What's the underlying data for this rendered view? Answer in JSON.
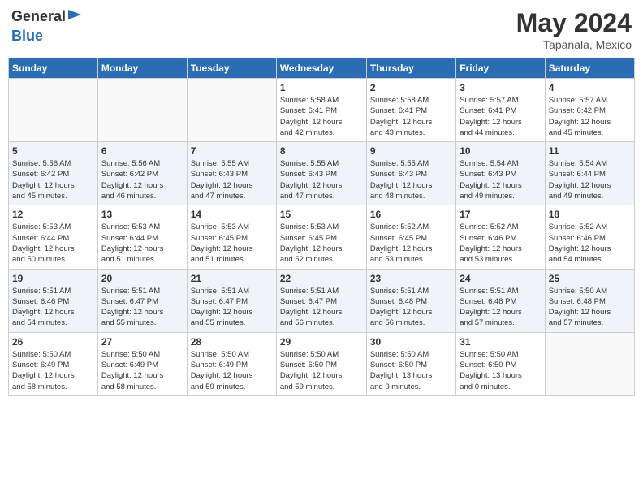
{
  "header": {
    "logo_general": "General",
    "logo_blue": "Blue",
    "month": "May 2024",
    "location": "Tapanala, Mexico"
  },
  "weekdays": [
    "Sunday",
    "Monday",
    "Tuesday",
    "Wednesday",
    "Thursday",
    "Friday",
    "Saturday"
  ],
  "weeks": [
    [
      {
        "day": "",
        "info": ""
      },
      {
        "day": "",
        "info": ""
      },
      {
        "day": "",
        "info": ""
      },
      {
        "day": "1",
        "info": "Sunrise: 5:58 AM\nSunset: 6:41 PM\nDaylight: 12 hours\nand 42 minutes."
      },
      {
        "day": "2",
        "info": "Sunrise: 5:58 AM\nSunset: 6:41 PM\nDaylight: 12 hours\nand 43 minutes."
      },
      {
        "day": "3",
        "info": "Sunrise: 5:57 AM\nSunset: 6:41 PM\nDaylight: 12 hours\nand 44 minutes."
      },
      {
        "day": "4",
        "info": "Sunrise: 5:57 AM\nSunset: 6:42 PM\nDaylight: 12 hours\nand 45 minutes."
      }
    ],
    [
      {
        "day": "5",
        "info": "Sunrise: 5:56 AM\nSunset: 6:42 PM\nDaylight: 12 hours\nand 45 minutes."
      },
      {
        "day": "6",
        "info": "Sunrise: 5:56 AM\nSunset: 6:42 PM\nDaylight: 12 hours\nand 46 minutes."
      },
      {
        "day": "7",
        "info": "Sunrise: 5:55 AM\nSunset: 6:43 PM\nDaylight: 12 hours\nand 47 minutes."
      },
      {
        "day": "8",
        "info": "Sunrise: 5:55 AM\nSunset: 6:43 PM\nDaylight: 12 hours\nand 47 minutes."
      },
      {
        "day": "9",
        "info": "Sunrise: 5:55 AM\nSunset: 6:43 PM\nDaylight: 12 hours\nand 48 minutes."
      },
      {
        "day": "10",
        "info": "Sunrise: 5:54 AM\nSunset: 6:43 PM\nDaylight: 12 hours\nand 49 minutes."
      },
      {
        "day": "11",
        "info": "Sunrise: 5:54 AM\nSunset: 6:44 PM\nDaylight: 12 hours\nand 49 minutes."
      }
    ],
    [
      {
        "day": "12",
        "info": "Sunrise: 5:53 AM\nSunset: 6:44 PM\nDaylight: 12 hours\nand 50 minutes."
      },
      {
        "day": "13",
        "info": "Sunrise: 5:53 AM\nSunset: 6:44 PM\nDaylight: 12 hours\nand 51 minutes."
      },
      {
        "day": "14",
        "info": "Sunrise: 5:53 AM\nSunset: 6:45 PM\nDaylight: 12 hours\nand 51 minutes."
      },
      {
        "day": "15",
        "info": "Sunrise: 5:53 AM\nSunset: 6:45 PM\nDaylight: 12 hours\nand 52 minutes."
      },
      {
        "day": "16",
        "info": "Sunrise: 5:52 AM\nSunset: 6:45 PM\nDaylight: 12 hours\nand 53 minutes."
      },
      {
        "day": "17",
        "info": "Sunrise: 5:52 AM\nSunset: 6:46 PM\nDaylight: 12 hours\nand 53 minutes."
      },
      {
        "day": "18",
        "info": "Sunrise: 5:52 AM\nSunset: 6:46 PM\nDaylight: 12 hours\nand 54 minutes."
      }
    ],
    [
      {
        "day": "19",
        "info": "Sunrise: 5:51 AM\nSunset: 6:46 PM\nDaylight: 12 hours\nand 54 minutes."
      },
      {
        "day": "20",
        "info": "Sunrise: 5:51 AM\nSunset: 6:47 PM\nDaylight: 12 hours\nand 55 minutes."
      },
      {
        "day": "21",
        "info": "Sunrise: 5:51 AM\nSunset: 6:47 PM\nDaylight: 12 hours\nand 55 minutes."
      },
      {
        "day": "22",
        "info": "Sunrise: 5:51 AM\nSunset: 6:47 PM\nDaylight: 12 hours\nand 56 minutes."
      },
      {
        "day": "23",
        "info": "Sunrise: 5:51 AM\nSunset: 6:48 PM\nDaylight: 12 hours\nand 56 minutes."
      },
      {
        "day": "24",
        "info": "Sunrise: 5:51 AM\nSunset: 6:48 PM\nDaylight: 12 hours\nand 57 minutes."
      },
      {
        "day": "25",
        "info": "Sunrise: 5:50 AM\nSunset: 6:48 PM\nDaylight: 12 hours\nand 57 minutes."
      }
    ],
    [
      {
        "day": "26",
        "info": "Sunrise: 5:50 AM\nSunset: 6:49 PM\nDaylight: 12 hours\nand 58 minutes."
      },
      {
        "day": "27",
        "info": "Sunrise: 5:50 AM\nSunset: 6:49 PM\nDaylight: 12 hours\nand 58 minutes."
      },
      {
        "day": "28",
        "info": "Sunrise: 5:50 AM\nSunset: 6:49 PM\nDaylight: 12 hours\nand 59 minutes."
      },
      {
        "day": "29",
        "info": "Sunrise: 5:50 AM\nSunset: 6:50 PM\nDaylight: 12 hours\nand 59 minutes."
      },
      {
        "day": "30",
        "info": "Sunrise: 5:50 AM\nSunset: 6:50 PM\nDaylight: 13 hours\nand 0 minutes."
      },
      {
        "day": "31",
        "info": "Sunrise: 5:50 AM\nSunset: 6:50 PM\nDaylight: 13 hours\nand 0 minutes."
      },
      {
        "day": "",
        "info": ""
      }
    ]
  ]
}
